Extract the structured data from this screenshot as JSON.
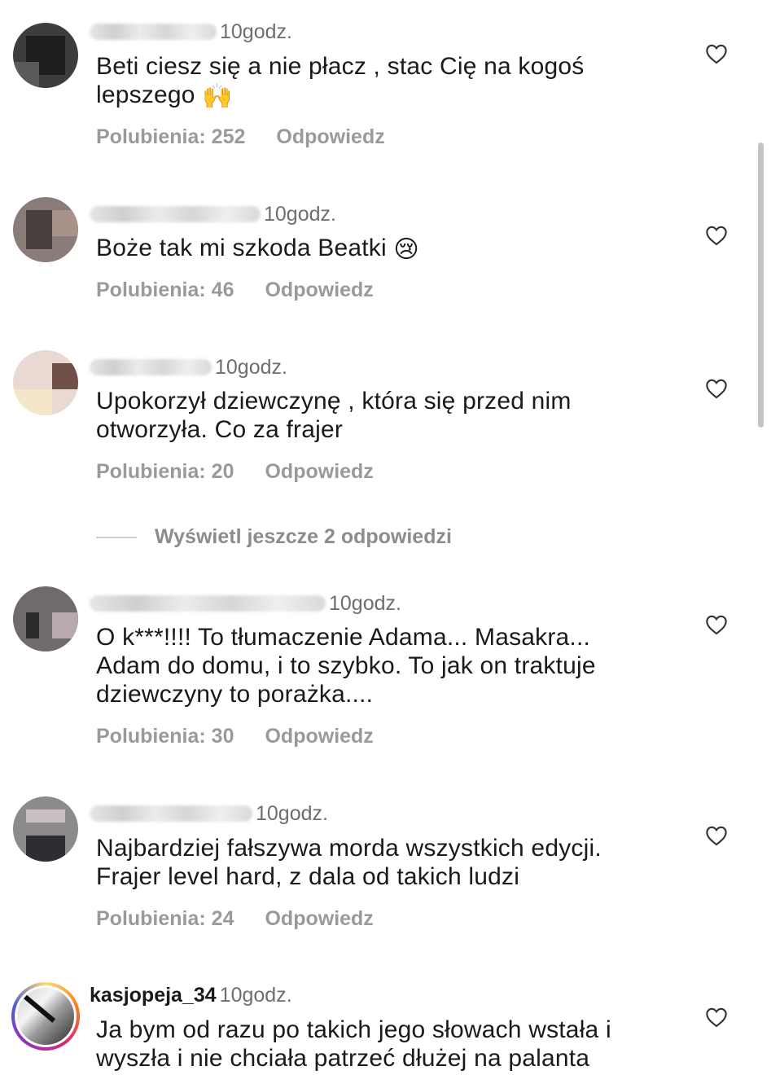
{
  "comments": [
    {
      "username": "",
      "time": "10godz.",
      "text": "Beti ciesz się a nie płacz , stac Cię na kogoś lepszego",
      "emoji": "🙌",
      "likes_label": "Polubienia: 252",
      "reply_label": "Odpowiedz"
    },
    {
      "username": "",
      "time": "10godz.",
      "text": "Boże tak mi szkoda Beatki",
      "emoji": "😢",
      "likes_label": "Polubienia: 46",
      "reply_label": "Odpowiedz"
    },
    {
      "username": "",
      "time": "10godz.",
      "text": "Upokorzył dziewczynę , która się przed nim otworzyła. Co za frajer",
      "emoji": "",
      "likes_label": "Polubienia: 20",
      "reply_label": "Odpowiedz"
    },
    {
      "username": "",
      "time": "10godz.",
      "text": "O k***!!!! To tłumaczenie Adama... Masakra... Adam do domu, i to szybko. To jak on traktuje dziewczyny to porażka....",
      "emoji": "",
      "likes_label": "Polubienia: 30",
      "reply_label": "Odpowiedz"
    },
    {
      "username": "",
      "time": "10godz.",
      "text": "Najbardziej fałszywa morda wszystkich edycji. Frajer level hard, z dala od takich ludzi",
      "emoji": "",
      "likes_label": "Polubienia: 24",
      "reply_label": "Odpowiedz"
    },
    {
      "username": "kasjopeja_34",
      "time": "10godz.",
      "text": "Ja bym od razu po takich jego słowach wstała i wyszła i nie chciała patrzeć dłużej na palanta",
      "emoji": "",
      "likes_label": "",
      "reply_label": ""
    }
  ],
  "thread": {
    "more_replies_label": "Wyświetl jeszcze 2 odpowiedzi"
  },
  "icons": {
    "like": "heart-outline-icon"
  },
  "colors": {
    "text": "#1a1a1a",
    "secondary": "#6e6e6e",
    "action": "#9a9a9a",
    "story_ring": [
      "#feda75",
      "#fa7e1e",
      "#d62976",
      "#962fbf",
      "#4f5bd5"
    ]
  }
}
